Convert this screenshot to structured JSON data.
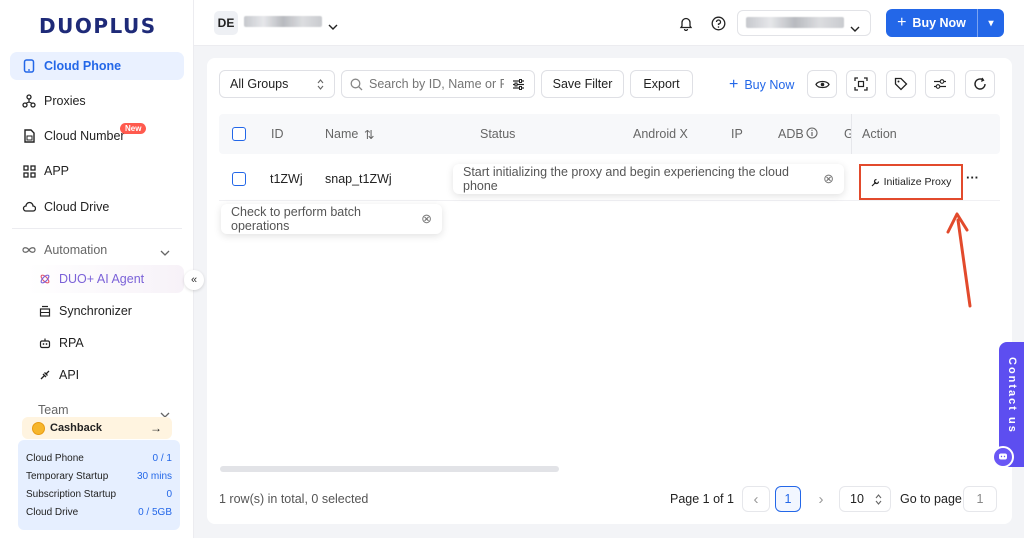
{
  "app": {
    "brand": "DUOPLUS"
  },
  "sidebar": {
    "items": [
      {
        "label": "Cloud Phone",
        "icon": "phone-icon"
      },
      {
        "label": "Proxies",
        "icon": "proxies-icon"
      },
      {
        "label": "Cloud Number",
        "icon": "sim-icon",
        "badge": "New"
      },
      {
        "label": "APP",
        "icon": "grid-icon"
      },
      {
        "label": "Cloud Drive",
        "icon": "cloud-icon"
      }
    ],
    "automation": {
      "label": "Automation",
      "items": [
        {
          "label": "DUO+ AI Agent",
          "icon": "ai-agent-icon"
        },
        {
          "label": "Synchronizer",
          "icon": "stack-icon"
        },
        {
          "label": "RPA",
          "icon": "robot-icon"
        },
        {
          "label": "API",
          "icon": "plug-icon"
        }
      ]
    },
    "team": {
      "label": "Team"
    },
    "collapse_glyph": "«",
    "cashback": {
      "label": "Cashback",
      "arrow": "→"
    },
    "usage": [
      {
        "label": "Cloud Phone",
        "value": "0 / 1"
      },
      {
        "label": "Temporary Startup",
        "value": "30 mins"
      },
      {
        "label": "Subscription Startup",
        "value": "0"
      },
      {
        "label": "Cloud Drive",
        "value": "0 / 5GB"
      }
    ]
  },
  "header": {
    "workspace_initials": "DE",
    "buy_now": "Buy Now",
    "buy_plus": "+",
    "buy_caret": "▾"
  },
  "toolbar": {
    "group_select": "All Groups",
    "search_placeholder": "Search by ID, Name or F",
    "save_filter": "Save Filter",
    "export": "Export",
    "buy_now": "Buy Now",
    "buy_plus": "+"
  },
  "table": {
    "columns": [
      "ID",
      "Name",
      "Status",
      "Android X",
      "IP",
      "ADB",
      "G",
      "Action"
    ],
    "sort_glyph": "⇅",
    "rows": [
      {
        "id": "t1ZWj",
        "name": "snap_t1ZWj",
        "action": "Initialize Proxy",
        "more": "···"
      }
    ],
    "tooltip_status": "Start initializing the proxy and begin experiencing the cloud phone",
    "tooltip_batch": "Check to perform batch operations",
    "tooltip_close": "⊗"
  },
  "footer": {
    "summary": "1 row(s) in total, 0 selected",
    "page_label": "Page 1 of 1",
    "current_page": "1",
    "prev": "‹",
    "next": "›",
    "page_size": "10",
    "goto_label": "Go to page",
    "goto_value": "1"
  },
  "contact": {
    "label": "Contact us"
  },
  "colors": {
    "accent": "#2367e8",
    "highlight": "#e24a2c",
    "contact": "#5d4ef0"
  }
}
